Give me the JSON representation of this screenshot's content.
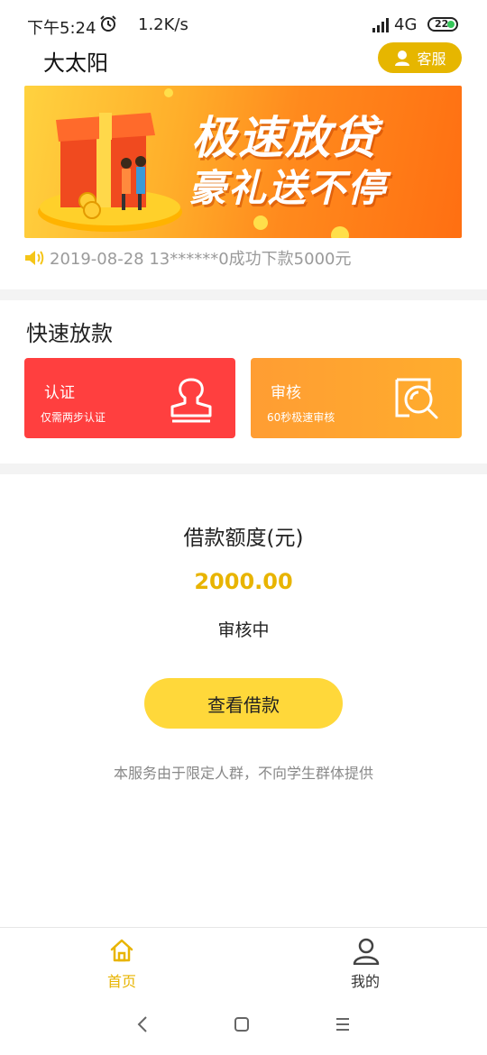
{
  "status_bar": {
    "time": "下午5:24",
    "speed": "1.2K/s",
    "network": "4G",
    "battery": "22"
  },
  "header": {
    "title": "大太阳",
    "service_label": "客服"
  },
  "banner": {
    "line1": "极速放贷",
    "line2": "豪礼送不停"
  },
  "notice": {
    "text": "2019-08-28 13******0成功下款5000元"
  },
  "quick_loan": {
    "title": "快速放款",
    "cards": [
      {
        "title": "认证",
        "subtitle": "仅需两步认证",
        "icon": "stamp-icon",
        "color": "#ff3f3f"
      },
      {
        "title": "审核",
        "subtitle": "60秒极速审核",
        "icon": "magnifier-icon",
        "color": "#ff9d33"
      }
    ]
  },
  "loan": {
    "label": "借款额度(元)",
    "amount": "2000.00",
    "status": "审核中",
    "view_button": "查看借款",
    "disclaimer": "本服务由于限定人群，不向学生群体提供"
  },
  "bottom_nav": {
    "items": [
      {
        "label": "首页",
        "icon": "home-icon",
        "active": true
      },
      {
        "label": "我的",
        "icon": "user-icon",
        "active": false
      }
    ]
  },
  "colors": {
    "accent": "#e8b400",
    "button": "#ffd83a",
    "red_card": "#ff3f3f",
    "orange_card": "#ff9d33"
  }
}
